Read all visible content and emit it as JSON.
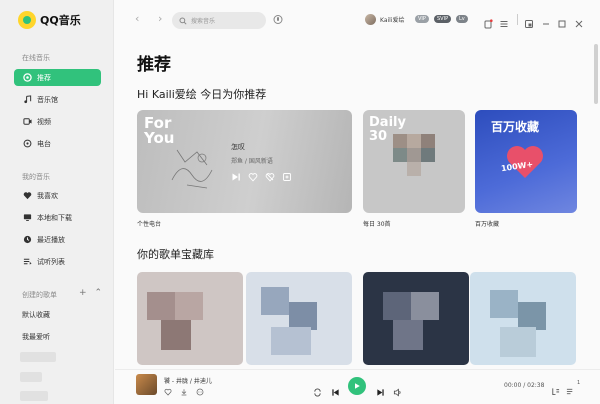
{
  "app": {
    "name": "QQ音乐"
  },
  "sidebar": {
    "online_section": "在线音乐",
    "online_items": [
      {
        "label": "推荐",
        "icon": "recommend-icon",
        "active": true
      },
      {
        "label": "音乐馆",
        "icon": "music-note-icon"
      },
      {
        "label": "视频",
        "icon": "video-icon"
      },
      {
        "label": "电台",
        "icon": "radio-icon"
      }
    ],
    "my_section": "我的音乐",
    "my_items": [
      {
        "label": "我喜欢",
        "icon": "heart-icon"
      },
      {
        "label": "本地和下载",
        "icon": "monitor-icon"
      },
      {
        "label": "最近播放",
        "icon": "clock-icon"
      },
      {
        "label": "试听列表",
        "icon": "playlist-icon"
      }
    ],
    "created_section": "创建的歌单",
    "created_items": [
      "默认收藏",
      "我最爱听"
    ]
  },
  "topbar": {
    "search_placeholder": "搜索音乐",
    "username": "Kaili爱绘",
    "badges": [
      "VIP",
      "SVIP",
      "Lv"
    ]
  },
  "main": {
    "title": "推荐",
    "greeting": "Hi Kaili爱绘 今日为你推荐",
    "cards": [
      {
        "title": "For You",
        "label": "个性电台",
        "song": "怎叹",
        "artist": "郑鱼 / 国风新语"
      },
      {
        "title": "Daily 30",
        "label": "每日 30首"
      },
      {
        "title": "百万收藏",
        "label": "百万收藏",
        "tag": "100W+"
      }
    ],
    "section2_title": "你的歌单宝藏库"
  },
  "player": {
    "now_playing": "饕 - 井胧 / 井迪儿",
    "time": "00:00 / 02:38",
    "queue_count": "1"
  },
  "colors": {
    "accent": "#31c27c",
    "sidebar_bg": "#f0f0f0",
    "main_bg": "#fafafa"
  }
}
